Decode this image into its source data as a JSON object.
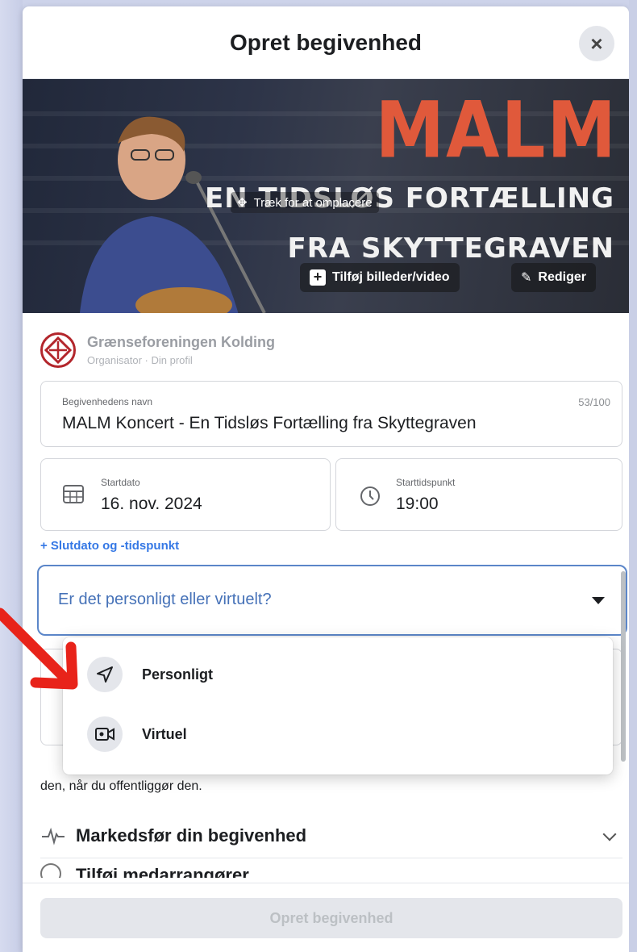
{
  "header": {
    "title": "Opret begivenhed",
    "close_icon": "×"
  },
  "banner": {
    "title_big": "MALM",
    "line2": "EN TIDSLØS FORTÆLLING",
    "line3": "FRA SKYTTEGRAVEN",
    "drag_hint": "Træk for at omplacere",
    "add_media_label": "Tilføj billeder/video",
    "edit_label": "Rediger"
  },
  "organizer": {
    "name": "Grænseforeningen Kolding",
    "role": "Organisator · Din profil"
  },
  "event_name": {
    "label": "Begivenhedens navn",
    "value": "MALM Koncert - En Tidsløs Fortælling fra Skyttegraven",
    "count": "53/100"
  },
  "start_date": {
    "label": "Startdato",
    "value": "16. nov. 2024"
  },
  "start_time": {
    "label": "Starttidspunkt",
    "value": "19:00"
  },
  "end_link": "+ Slutdato og -tidspunkt",
  "location_type": {
    "placeholder": "Er det personligt eller virtuelt?",
    "options": [
      {
        "label": "Personligt",
        "icon": "location-arrow-icon"
      },
      {
        "label": "Virtuel",
        "icon": "video-camera-icon"
      }
    ]
  },
  "help_text": "den, når du offentliggør den.",
  "promote": {
    "label": "Markedsfør din begivenhed"
  },
  "cohosts": {
    "label": "Tilføj medarrangører"
  },
  "footer": {
    "create_label": "Opret begivenhed"
  },
  "colors": {
    "accent": "#3578e5",
    "annotation_arrow": "#e8231a",
    "banner_title": "#e0593b"
  }
}
